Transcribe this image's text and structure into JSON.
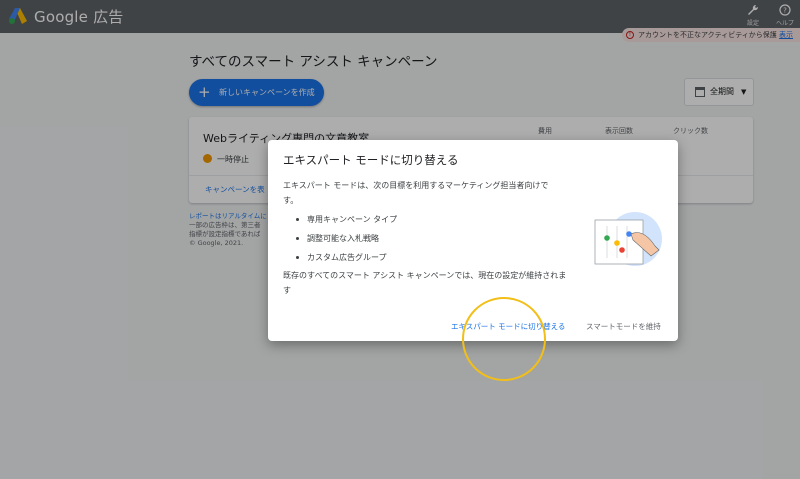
{
  "header": {
    "logo_text": "Google 広告",
    "settings_label": "設定",
    "help_label": "ヘルプ",
    "settings_icon": "wrench-icon",
    "help_icon": "help-circle-icon"
  },
  "alert": {
    "icon": "error-icon",
    "text": "アカウントを不正なアクティビティから保護",
    "link_text": "表示"
  },
  "main": {
    "title": "すべてのスマート アシスト キャンペーン",
    "new_campaign_label": "新しいキャンペーンを作成",
    "date_range_label": "全期間"
  },
  "campaign_card": {
    "name": "Webライティング専門の文章教室",
    "status": "一時停止",
    "columns": [
      "費用",
      "表示回数",
      "クリック数"
    ],
    "link_text": "キャンペーンを表"
  },
  "footer": {
    "link_text": "レポートはリアルタイムに",
    "line1": "一部の広告枠は、第三者",
    "line2": "指標が設定指標であれば",
    "copyright": "© Google, 2021."
  },
  "dialog": {
    "title": "エキスパート モードに切り替える",
    "body": "エキスパート モードは、次の目標を利用するマーケティング担当者向けです。",
    "features": [
      "専用キャンペーン タイプ",
      "調整可能な入札戦略",
      "カスタム広告グループ"
    ],
    "note": "既存のすべてのスマート アシスト キャンペーンでは、現在の設定が維持されます",
    "switch_button": "エキスパート モードに切り替える",
    "keep_button": "スマートモードを維持"
  },
  "colors": {
    "header_bg": "#5f6368",
    "primary": "#1a73e8",
    "paused": "#f29900",
    "highlight": "#f2bf19"
  }
}
